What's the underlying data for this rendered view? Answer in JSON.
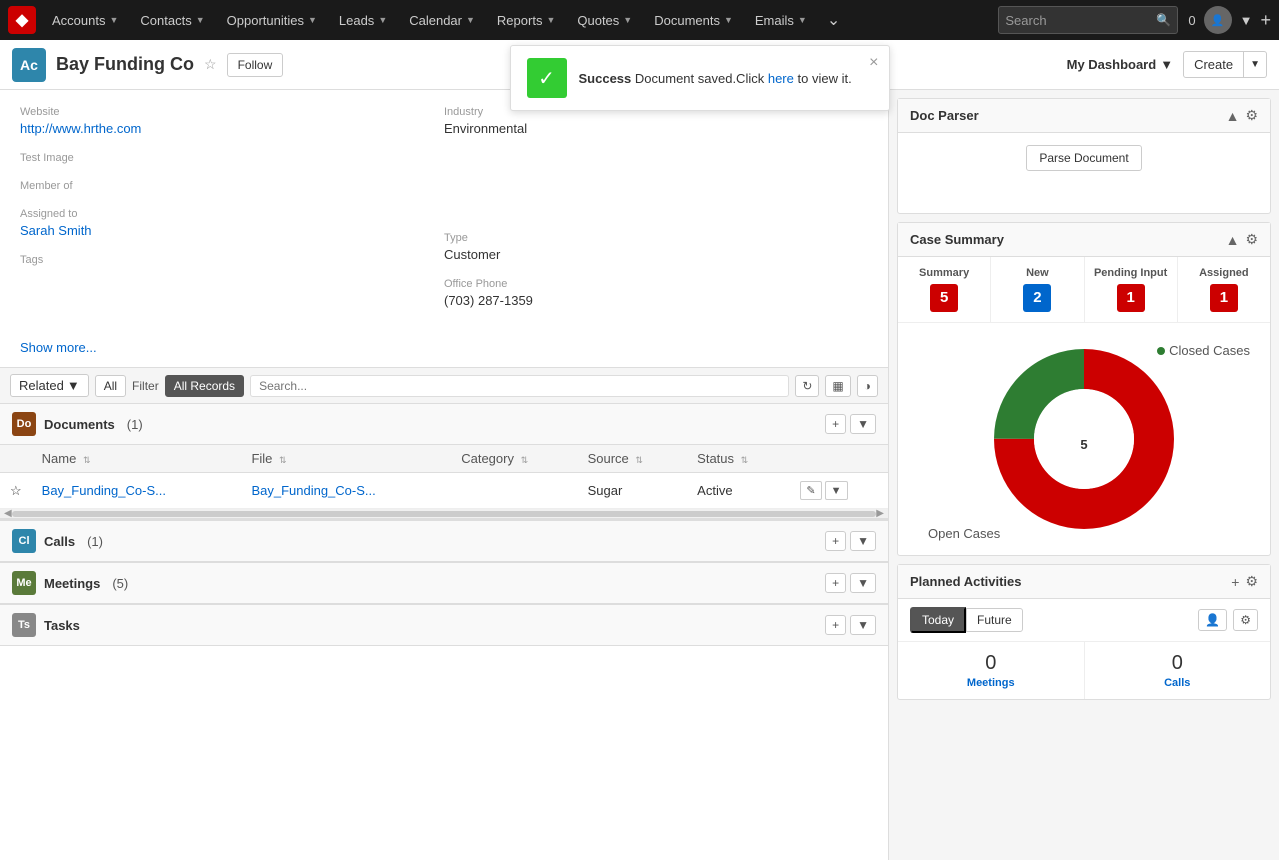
{
  "nav": {
    "logo": "◆",
    "items": [
      {
        "label": "Accounts",
        "id": "accounts"
      },
      {
        "label": "Contacts",
        "id": "contacts"
      },
      {
        "label": "Opportunities",
        "id": "opportunities"
      },
      {
        "label": "Leads",
        "id": "leads"
      },
      {
        "label": "Calendar",
        "id": "calendar"
      },
      {
        "label": "Reports",
        "id": "reports"
      },
      {
        "label": "Quotes",
        "id": "quotes"
      },
      {
        "label": "Documents",
        "id": "documents"
      },
      {
        "label": "Emails",
        "id": "emails"
      }
    ],
    "search_placeholder": "Search",
    "badge_count": "0"
  },
  "header": {
    "account_initials": "Ac",
    "account_name": "Bay Funding Co",
    "follow_label": "Follow",
    "dashboard_label": "My Dashboard",
    "create_label": "Create"
  },
  "toast": {
    "message_bold": "Success",
    "message": " Document saved.Click ",
    "link_text": "here",
    "message_end": " to view it."
  },
  "form": {
    "website_label": "Website",
    "website_value": "http://www.hrthe.com",
    "industry_label": "Industry",
    "industry_value": "Environmental",
    "test_image_label": "Test Image",
    "member_of_label": "Member of",
    "type_label": "Type",
    "type_value": "Customer",
    "assigned_to_label": "Assigned to",
    "assigned_to_value": "Sarah Smith",
    "office_phone_label": "Office Phone",
    "office_phone_value": "(703) 287-1359",
    "tags_label": "Tags",
    "show_more": "Show more..."
  },
  "related_toolbar": {
    "related_label": "Related",
    "all_label": "All",
    "filter_label": "Filter",
    "all_records_label": "All Records",
    "search_placeholder": "Search..."
  },
  "documents_subpanel": {
    "icon_initials": "Do",
    "icon_bg": "#8B4513",
    "title": "Documents",
    "count": "(1)",
    "columns": [
      "Name",
      "File",
      "Category",
      "Source",
      "Status"
    ],
    "rows": [
      {
        "name": "Bay_Funding_Co-S...",
        "file": "Bay_Funding_Co-S...",
        "category": "",
        "source": "Sugar",
        "status": "Active"
      }
    ]
  },
  "calls_subpanel": {
    "icon_initials": "Cl",
    "icon_bg": "#2E86AB",
    "title": "Calls",
    "count": "(1)"
  },
  "meetings_subpanel": {
    "icon_initials": "Me",
    "icon_bg": "#5a7a3a",
    "title": "Meetings",
    "count": "(5)"
  },
  "tasks_subpanel": {
    "icon_initials": "Ts",
    "icon_bg": "#888",
    "title": "Tasks",
    "count": ""
  },
  "doc_parser": {
    "title": "Doc Parser",
    "parse_button_label": "Parse Document"
  },
  "case_summary": {
    "title": "Case Summary",
    "columns": [
      {
        "label": "Summary",
        "value": "5",
        "color": "badge-red"
      },
      {
        "label": "New",
        "value": "2",
        "color": "badge-blue"
      },
      {
        "label": "Pending Input",
        "value": "1",
        "color": "badge-red"
      },
      {
        "label": "Assigned",
        "value": "1",
        "color": "badge-red"
      }
    ],
    "donut_center": "5",
    "legend_closed": "Closed Cases",
    "legend_open": "Open Cases"
  },
  "planned_activities": {
    "title": "Planned Activities",
    "tab_today": "Today",
    "tab_future": "Future",
    "meetings_count": "0",
    "meetings_label": "Meetings",
    "calls_count": "0",
    "calls_label": "Calls"
  }
}
